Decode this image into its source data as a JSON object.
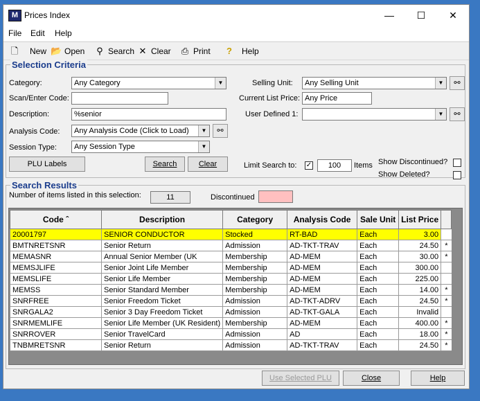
{
  "window": {
    "title": "Prices Index",
    "icon_text": "M",
    "minimize": "—",
    "maximize": "☐",
    "close": "✕"
  },
  "menu": [
    "File",
    "Edit",
    "Help"
  ],
  "toolbar": {
    "new": "New",
    "open": "Open",
    "search": "Search",
    "clear": "Clear",
    "print": "Print",
    "help": "Help"
  },
  "criteria": {
    "title": "Selection Criteria",
    "category_label": "Category:",
    "category_value": "Any Category",
    "scan_label": "Scan/Enter Code:",
    "scan_value": "",
    "description_label": "Description:",
    "description_value": "%senior",
    "analysis_label": "Analysis Code:",
    "analysis_value": "Any Analysis Code (Click to Load)",
    "session_label": "Session Type:",
    "session_value": "Any Session Type",
    "selling_unit_label": "Selling Unit:",
    "selling_unit_value": "Any Selling Unit",
    "list_price_label": "Current List Price:",
    "list_price_value": "Any Price",
    "user_defined_label": "User Defined 1:",
    "user_defined_value": "",
    "plu_labels": "PLU Labels",
    "search": "Search",
    "clear": "Clear",
    "limit_label": "Limit Search to:",
    "limit_checked": "✓",
    "limit_value": "100",
    "items_label": "Items",
    "show_discontinued": "Show Discontinued?",
    "show_deleted": "Show Deleted?"
  },
  "results": {
    "title": "Search Results",
    "count_label": "Number of items listed in this selection:",
    "count_value": "11",
    "discontinued_label": "Discontinued",
    "discontinued_color": "#ffc0c0",
    "columns": [
      "Code ˆ",
      "Description",
      "Category",
      "Analysis Code",
      "Sale Unit",
      "List Price"
    ],
    "rows": [
      {
        "code": "20001797",
        "description": "SENIOR CONDUCTOR",
        "category": "Stocked",
        "analysis": "RT-BAD",
        "unit": "Each",
        "price": "3.00",
        "flag": ""
      },
      {
        "code": "BMTNRETSNR",
        "description": "Senior Return",
        "category": "Admission",
        "analysis": "AD-TKT-TRAV",
        "unit": "Each",
        "price": "24.50",
        "flag": "*"
      },
      {
        "code": "MEMASNR",
        "description": "Annual Senior Member (UK",
        "category": "Membership",
        "analysis": "AD-MEM",
        "unit": "Each",
        "price": "30.00",
        "flag": "*"
      },
      {
        "code": "MEMSJLIFE",
        "description": "Senior Joint Life Member",
        "category": "Membership",
        "analysis": "AD-MEM",
        "unit": "Each",
        "price": "300.00",
        "flag": ""
      },
      {
        "code": "MEMSLIFE",
        "description": "Senior Life Member",
        "category": "Membership",
        "analysis": "AD-MEM",
        "unit": "Each",
        "price": "225.00",
        "flag": ""
      },
      {
        "code": "MEMSS",
        "description": "Senior Standard Member",
        "category": "Membership",
        "analysis": "AD-MEM",
        "unit": "Each",
        "price": "14.00",
        "flag": "*"
      },
      {
        "code": "SNRFREE",
        "description": "Senior Freedom Ticket",
        "category": "Admission",
        "analysis": "AD-TKT-ADRV",
        "unit": "Each",
        "price": "24.50",
        "flag": "*"
      },
      {
        "code": "SNRGALA2",
        "description": "Senior 3 Day Freedom Ticket",
        "category": "Admission",
        "analysis": "AD-TKT-GALA",
        "unit": "Each",
        "price": "Invalid",
        "flag": ""
      },
      {
        "code": "SNRMEMLIFE",
        "description": "Senior Life Member (UK Resident)",
        "category": "Membership",
        "analysis": "AD-MEM",
        "unit": "Each",
        "price": "400.00",
        "flag": "*"
      },
      {
        "code": "SNRROVER",
        "description": "Senior TravelCard",
        "category": "Admission",
        "analysis": "AD",
        "unit": "Each",
        "price": "18.00",
        "flag": "*"
      },
      {
        "code": "TNBMRETSNR",
        "description": "Senior Return",
        "category": "Admission",
        "analysis": "AD-TKT-TRAV",
        "unit": "Each",
        "price": "24.50",
        "flag": "*"
      }
    ]
  },
  "footer": {
    "use_selected": "Use Selected PLU",
    "close": "Close",
    "help": "Help"
  }
}
